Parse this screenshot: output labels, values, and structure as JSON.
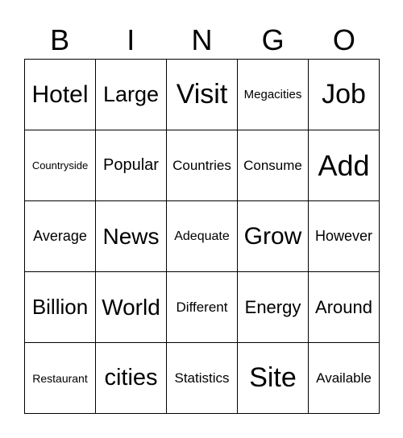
{
  "header": [
    "B",
    "I",
    "N",
    "G",
    "O"
  ],
  "cells": [
    {
      "word": "Hotel",
      "size": 30
    },
    {
      "word": "Large",
      "size": 27
    },
    {
      "word": "Visit",
      "size": 34
    },
    {
      "word": "Megacities",
      "size": 15
    },
    {
      "word": "Job",
      "size": 34
    },
    {
      "word": "Countryside",
      "size": 13
    },
    {
      "word": "Popular",
      "size": 20
    },
    {
      "word": "Countries",
      "size": 17
    },
    {
      "word": "Consume",
      "size": 17
    },
    {
      "word": "Add",
      "size": 36
    },
    {
      "word": "Average",
      "size": 18
    },
    {
      "word": "News",
      "size": 28
    },
    {
      "word": "Adequate",
      "size": 16
    },
    {
      "word": "Grow",
      "size": 30
    },
    {
      "word": "However",
      "size": 18
    },
    {
      "word": "Billion",
      "size": 26
    },
    {
      "word": "World",
      "size": 28
    },
    {
      "word": "Different",
      "size": 17
    },
    {
      "word": "Energy",
      "size": 22
    },
    {
      "word": "Around",
      "size": 22
    },
    {
      "word": "Restaurant",
      "size": 14
    },
    {
      "word": "cities",
      "size": 29
    },
    {
      "word": "Statistics",
      "size": 17
    },
    {
      "word": "Site",
      "size": 34
    },
    {
      "word": "Available",
      "size": 17
    }
  ]
}
